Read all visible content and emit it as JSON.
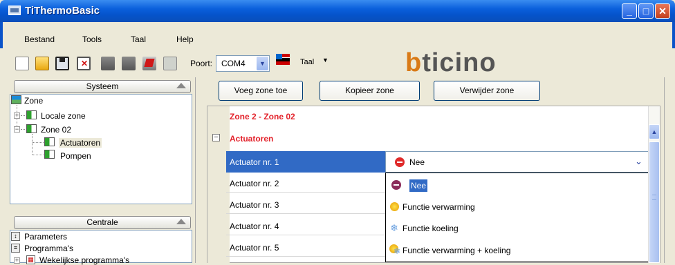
{
  "window": {
    "title": "TiThermoBasic"
  },
  "menu": [
    "Bestand",
    "Tools",
    "Taal",
    "Help"
  ],
  "toolbar": {
    "port_label": "Poort:",
    "port_value": "COM4",
    "taal_label": "Taal",
    "brand": "bticino"
  },
  "systeem": {
    "header": "Systeem",
    "tree": [
      "Zone",
      "Locale zone",
      "Zone 02",
      "Actuatoren",
      "Pompen"
    ]
  },
  "centrale": {
    "header": "Centrale",
    "tree": [
      "Parameters",
      "Programma's",
      "Wekelijkse programma's"
    ]
  },
  "actions": {
    "add_zone": "Voeg zone toe",
    "copy_zone": "Kopieer zone",
    "remove_zone": "Verwijder zone"
  },
  "grid": {
    "zone_title": "Zone 2 - Zone 02",
    "section_title": "Actuatoren",
    "rows": [
      "Actuator nr. 1",
      "Actuator nr. 2",
      "Actuator nr. 3",
      "Actuator nr. 4",
      "Actuator nr. 5"
    ],
    "selected_value": "Nee"
  },
  "dropdown": {
    "options": [
      "Nee",
      "Functie verwarming",
      "Functie koeling",
      "Functie verwarming + koeling"
    ]
  }
}
